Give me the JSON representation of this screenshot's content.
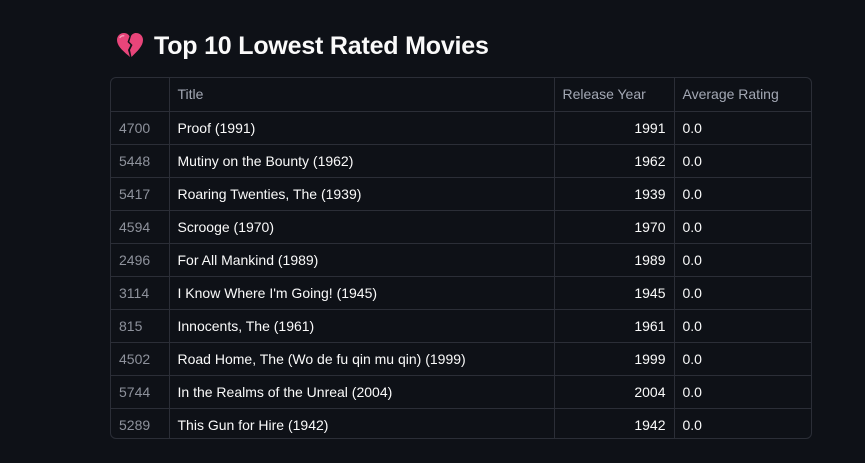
{
  "header": {
    "icon": "broken-heart-icon",
    "title": "Top 10 Lowest Rated Movies"
  },
  "table": {
    "columns": [
      "",
      "Title",
      "Release Year",
      "Average Rating"
    ],
    "rows": [
      {
        "index": "4700",
        "title": "Proof (1991)",
        "year": "1991",
        "rating": "0.0"
      },
      {
        "index": "5448",
        "title": "Mutiny on the Bounty (1962)",
        "year": "1962",
        "rating": "0.0"
      },
      {
        "index": "5417",
        "title": "Roaring Twenties, The (1939)",
        "year": "1939",
        "rating": "0.0"
      },
      {
        "index": "4594",
        "title": "Scrooge (1970)",
        "year": "1970",
        "rating": "0.0"
      },
      {
        "index": "2496",
        "title": "For All Mankind (1989)",
        "year": "1989",
        "rating": "0.0"
      },
      {
        "index": "3114",
        "title": "I Know Where I'm Going! (1945)",
        "year": "1945",
        "rating": "0.0"
      },
      {
        "index": "815",
        "title": "Innocents, The (1961)",
        "year": "1961",
        "rating": "0.0"
      },
      {
        "index": "4502",
        "title": "Road Home, The (Wo de fu qin mu qin) (1999)",
        "year": "1999",
        "rating": "0.0"
      },
      {
        "index": "5744",
        "title": "In the Realms of the Unreal (2004)",
        "year": "2004",
        "rating": "0.0"
      },
      {
        "index": "5289",
        "title": "This Gun for Hire (1942)",
        "year": "1942",
        "rating": "0.0"
      }
    ]
  },
  "colors": {
    "background": "#0e1117",
    "text": "#fafafa",
    "muted": "#a3a8b4",
    "border": "#2b2e37",
    "heart": "#e8457a"
  }
}
